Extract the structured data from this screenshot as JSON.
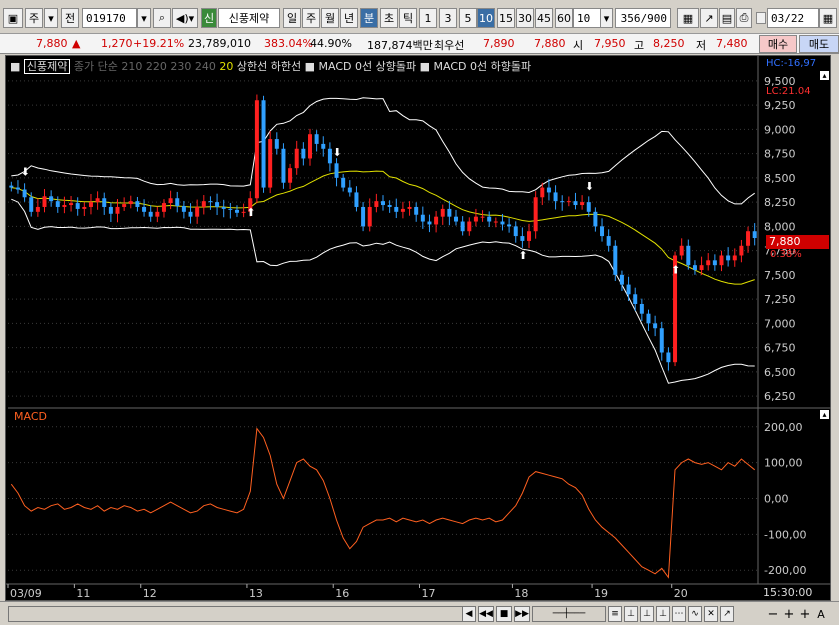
{
  "toolbar": {
    "mode": "주",
    "prev_label": "전",
    "code": "019170",
    "market_badge": "신",
    "name": "신풍제약",
    "periods": [
      "일",
      "주",
      "월",
      "년",
      "분",
      "초",
      "틱"
    ],
    "active_period": "분",
    "intervals": [
      "1",
      "3",
      "5",
      "10",
      "15",
      "30",
      "45",
      "60"
    ],
    "active_interval": "10",
    "count_value": "10",
    "range_display": "356/900",
    "date_value": "03/22"
  },
  "quote": {
    "price": "7,880",
    "arrow": "▲",
    "change": "1,270",
    "change_pct": "+19.21%",
    "volume": "23,789,010",
    "vol_ratio": "383.04%",
    "turnover_pct": "44.90%",
    "trade_value": "187,874백만",
    "best_label": "최우선",
    "best_ask": "7,890",
    "best_bid": "7,880",
    "open_label": "시",
    "open": "7,950",
    "high_label": "고",
    "high": "8,250",
    "low_label": "저",
    "low": "7,480",
    "buy_label": "매수",
    "sell_label": "매도"
  },
  "legend": {
    "name": "신풍제약",
    "ma": "종가 단순",
    "ma_periods": [
      "210",
      "220",
      "230",
      "240"
    ],
    "bb_period": "20",
    "upper": "상한선",
    "lower": "하한선",
    "macd_up": "MACD 0선 상향돌파",
    "macd_down": "MACD 0선 하향돌파"
  },
  "price_axis": {
    "hc": "HC:-16,97",
    "lc": "LC:21.04",
    "current": "7,880",
    "current_pct": "0.38%",
    "ticks": [
      "9,500",
      "9,250",
      "9,000",
      "8,750",
      "8,500",
      "8,250",
      "8,000",
      "7,750",
      "7,500",
      "7,250",
      "7,000",
      "6,750",
      "6,500",
      "6,250"
    ]
  },
  "macd_panel": {
    "label": "MACD",
    "ticks": [
      "200,00",
      "100,00",
      "0,00",
      "-100,00",
      "-200,00"
    ]
  },
  "time_axis": {
    "labels": [
      "03/09",
      "11",
      "12",
      "13",
      "16",
      "17",
      "18",
      "19",
      "20"
    ],
    "current_time": "15:30:00"
  },
  "colors": {
    "up": "#ff2020",
    "down": "#30a0ff",
    "bands": "#ffffff",
    "ma_line": "#e0e000",
    "macd": "#ff6020",
    "grid": "#3a3a3a"
  },
  "chart_data": {
    "type": "candlestick",
    "price_range": [
      6200,
      9550
    ],
    "macd_range": [
      -230,
      230
    ],
    "close": [
      8400,
      8380,
      8300,
      8150,
      8200,
      8310,
      8260,
      8200,
      8220,
      8240,
      8180,
      8200,
      8250,
      8290,
      8200,
      8130,
      8200,
      8230,
      8260,
      8200,
      8150,
      8100,
      8150,
      8240,
      8290,
      8210,
      8150,
      8100,
      8200,
      8260,
      8250,
      8200,
      8180,
      8170,
      8140,
      8150,
      8290,
      9300,
      8400,
      8900,
      8800,
      8450,
      8600,
      8800,
      8700,
      8950,
      8850,
      8800,
      8650,
      8500,
      8400,
      8350,
      8200,
      8000,
      8200,
      8260,
      8220,
      8200,
      8150,
      8180,
      8200,
      8120,
      8050,
      8020,
      8100,
      8180,
      8100,
      8050,
      7950,
      8050,
      8100,
      8100,
      8050,
      8050,
      8020,
      8000,
      7900,
      7850,
      7950,
      8300,
      8400,
      8350,
      8260,
      8250,
      8260,
      8220,
      8250,
      8150,
      8000,
      7900,
      7800,
      7500,
      7400,
      7300,
      7200,
      7100,
      7000,
      6950,
      6700,
      6600,
      7700,
      7800,
      7600,
      7550,
      7600,
      7650,
      7600,
      7700,
      7650,
      7700,
      7800,
      7950,
      7880
    ],
    "macd": [
      40,
      15,
      -20,
      -35,
      -25,
      -30,
      -20,
      -15,
      -30,
      -25,
      -15,
      -25,
      -30,
      -20,
      -35,
      -25,
      -30,
      -20,
      -25,
      -35,
      -30,
      -40,
      -30,
      -20,
      -10,
      -20,
      -30,
      -40,
      -35,
      -20,
      -15,
      -25,
      -30,
      -35,
      -40,
      -30,
      20,
      195,
      170,
      120,
      40,
      0,
      50,
      100,
      110,
      90,
      80,
      50,
      0,
      -60,
      -110,
      -140,
      -120,
      -80,
      -70,
      -60,
      -60,
      -55,
      -65,
      -55,
      -60,
      -65,
      -60,
      -70,
      -60,
      -55,
      -60,
      -65,
      -70,
      -60,
      -55,
      -60,
      -55,
      -65,
      -60,
      -40,
      -20,
      15,
      60,
      75,
      70,
      65,
      60,
      55,
      40,
      30,
      10,
      -30,
      -60,
      -80,
      -95,
      -110,
      -130,
      -150,
      -170,
      -190,
      -200,
      -210,
      -195,
      -220,
      80,
      100,
      110,
      100,
      95,
      100,
      90,
      80,
      100,
      90,
      110,
      95,
      80
    ]
  }
}
